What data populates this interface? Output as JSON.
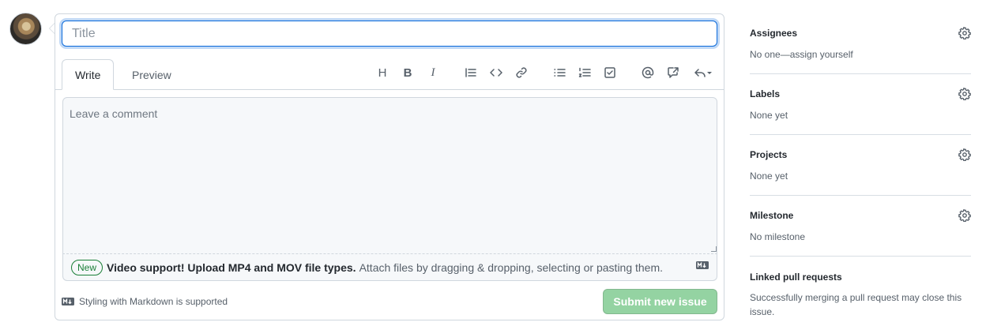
{
  "title_field": {
    "placeholder": "Title",
    "value": ""
  },
  "tabs": {
    "write": "Write",
    "preview": "Preview"
  },
  "toolbar": {
    "heading": "H",
    "bold": "B",
    "italic": "I",
    "icons": [
      "heading-icon",
      "bold-icon",
      "italic-icon",
      "quote-icon",
      "code-icon",
      "link-icon",
      "unordered-list-icon",
      "ordered-list-icon",
      "task-list-icon",
      "mention-icon",
      "reference-icon",
      "reply-icon"
    ]
  },
  "comment": {
    "placeholder": "Leave a comment",
    "value": ""
  },
  "upload": {
    "badge": "New",
    "strong": "Video support! Upload MP4 and MOV file types.",
    "text": "Attach files by dragging & dropping, selecting or pasting them."
  },
  "footer": {
    "markdown": "Styling with Markdown is supported"
  },
  "submit": {
    "label": "Submit new issue"
  },
  "sidebar": {
    "assignees": {
      "title": "Assignees",
      "value": "No one—assign yourself"
    },
    "labels": {
      "title": "Labels",
      "value": "None yet"
    },
    "projects": {
      "title": "Projects",
      "value": "None yet"
    },
    "milestone": {
      "title": "Milestone",
      "value": "No milestone"
    },
    "linked": {
      "title": "Linked pull requests",
      "value": "Successfully merging a pull request may close this issue."
    }
  },
  "colors": {
    "accent": "#0969da",
    "submit_bg": "#94d3a2",
    "new_badge": "#1a7f37"
  }
}
